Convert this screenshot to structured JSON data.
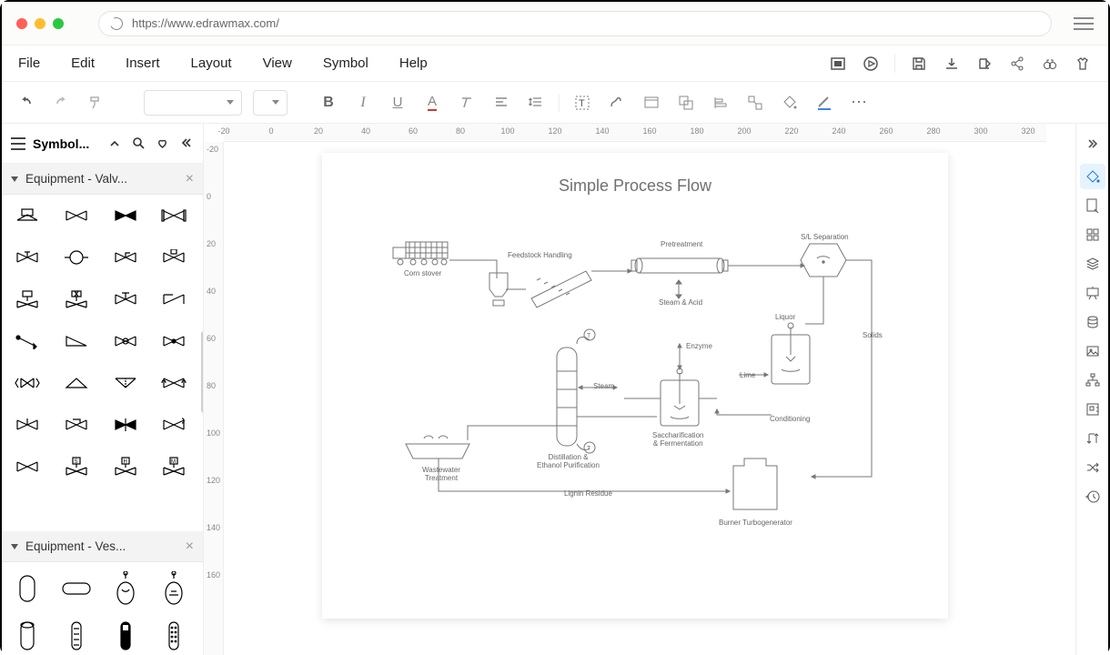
{
  "app": {
    "url": "https://www.edrawmax.com/"
  },
  "menu": {
    "items": [
      "File",
      "Edit",
      "Insert",
      "Layout",
      "View",
      "Symbol",
      "Help"
    ]
  },
  "topright_icons": [
    "present-rect",
    "play-circle",
    "save",
    "download",
    "export",
    "share-nodes",
    "binoculars",
    "shirt"
  ],
  "editbar_icons": [
    "undo",
    "redo",
    "format-painter",
    "font-family",
    "font-size",
    "bold",
    "italic",
    "underline",
    "text-color",
    "clear-format",
    "align",
    "line-spacing",
    "text-frame",
    "connector",
    "container",
    "group",
    "align-objects",
    "distribute",
    "fill",
    "stroke",
    "more"
  ],
  "left": {
    "header_label": "Symbol...",
    "header_icons": [
      "expand-up",
      "search",
      "heart",
      "collapse-left"
    ],
    "sections": [
      {
        "title": "Equipment - Valv...",
        "kind": "valves",
        "count": 28
      },
      {
        "title": "Equipment - Ves...",
        "kind": "vessels",
        "count": 8
      }
    ]
  },
  "ruler": {
    "h": [
      "-20",
      "0",
      "20",
      "40",
      "60",
      "80",
      "100",
      "120",
      "140",
      "160",
      "180",
      "200",
      "220",
      "240",
      "260",
      "280",
      "300",
      "320"
    ],
    "v": [
      "-20",
      "0",
      "20",
      "40",
      "60",
      "80",
      "100",
      "120",
      "140",
      "160"
    ]
  },
  "page": {
    "title": "Simple Process Flow",
    "labels": {
      "corn_stover": "Corn stover",
      "feedstock": "Feedstock Handling",
      "pretreatment": "Pretreatment",
      "sl_separation": "S/L Separation",
      "steam_acid": "Steam & Acid",
      "liquor": "Liquor",
      "solids": "Solids",
      "enzyme": "Enzyme",
      "lime": "Lime",
      "conditioning": "Conditioning",
      "steam": "Steam",
      "sacc": "Saccharification\n& Fermentation",
      "distill": "Distillation &\nEthanol Purification",
      "wastewater": "Wastewater\nTreatment",
      "lignin": "Lignin Residue",
      "burner": "Burner Turbogenerator"
    }
  },
  "rightpane_icons": [
    "collapse-right",
    "paint-bucket",
    "page-settings",
    "grid",
    "layers",
    "presentation",
    "database",
    "image",
    "sitemap",
    "ruler-panel",
    "text-direction",
    "shuffle",
    "history"
  ]
}
